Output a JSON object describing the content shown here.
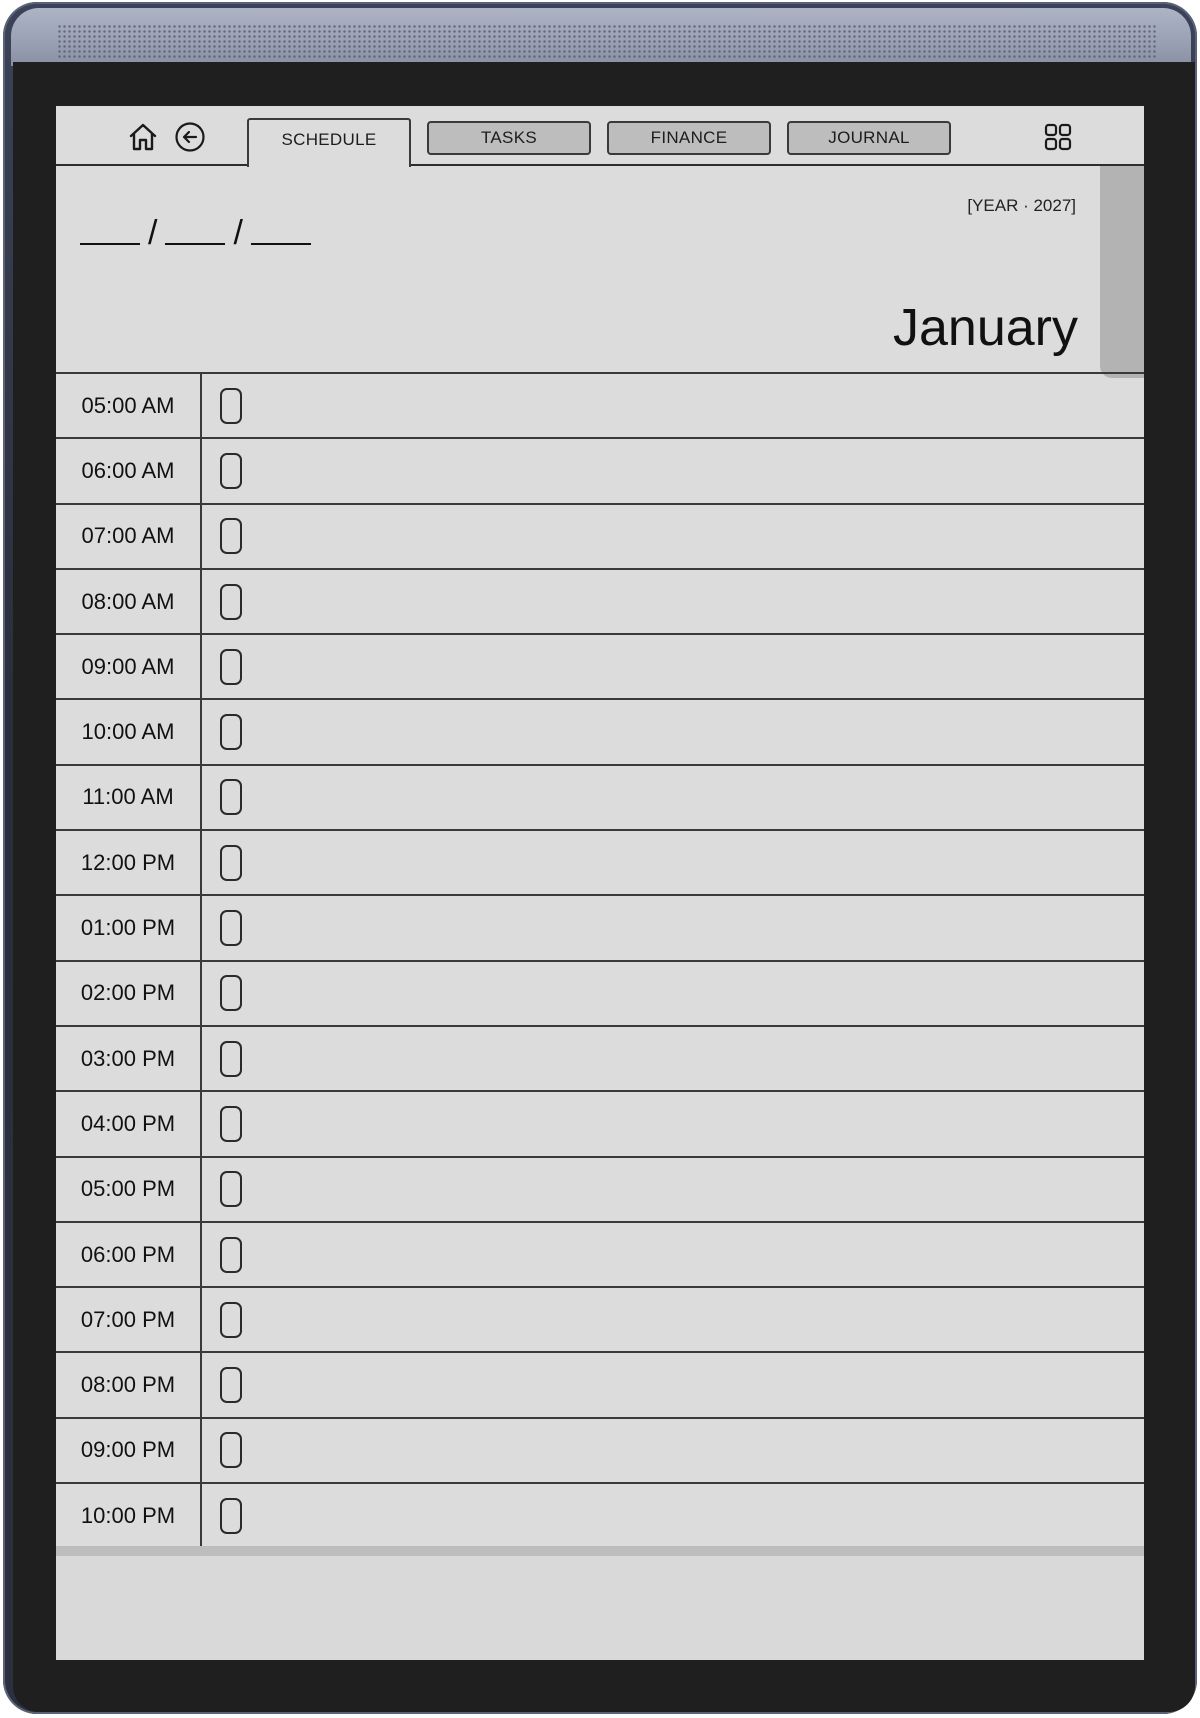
{
  "nav": {
    "tabs": [
      {
        "label": "SCHEDULE",
        "active": true
      },
      {
        "label": "TASKS",
        "active": false
      },
      {
        "label": "FINANCE",
        "active": false
      },
      {
        "label": "JOURNAL",
        "active": false
      }
    ],
    "icons": {
      "home": "home-icon",
      "back": "back-arrow-icon",
      "grid": "grid-icon"
    }
  },
  "header": {
    "date_separator": "/",
    "year_label": "[YEAR · 2027]",
    "month": "January"
  },
  "schedule": {
    "times": [
      "05:00 AM",
      "06:00 AM",
      "07:00 AM",
      "08:00 AM",
      "09:00 AM",
      "10:00 AM",
      "11:00 AM",
      "12:00 PM",
      "01:00 PM",
      "02:00 PM",
      "03:00 PM",
      "04:00 PM",
      "05:00 PM",
      "06:00 PM",
      "07:00 PM",
      "08:00 PM",
      "09:00 PM",
      "10:00 PM"
    ]
  },
  "colors": {
    "screen": "#dcdcdc",
    "inactive_tab": "#bdbdbd",
    "lines": "#3a3a3a",
    "bezel": "#1f1f1f",
    "frame": "#2b303f"
  }
}
